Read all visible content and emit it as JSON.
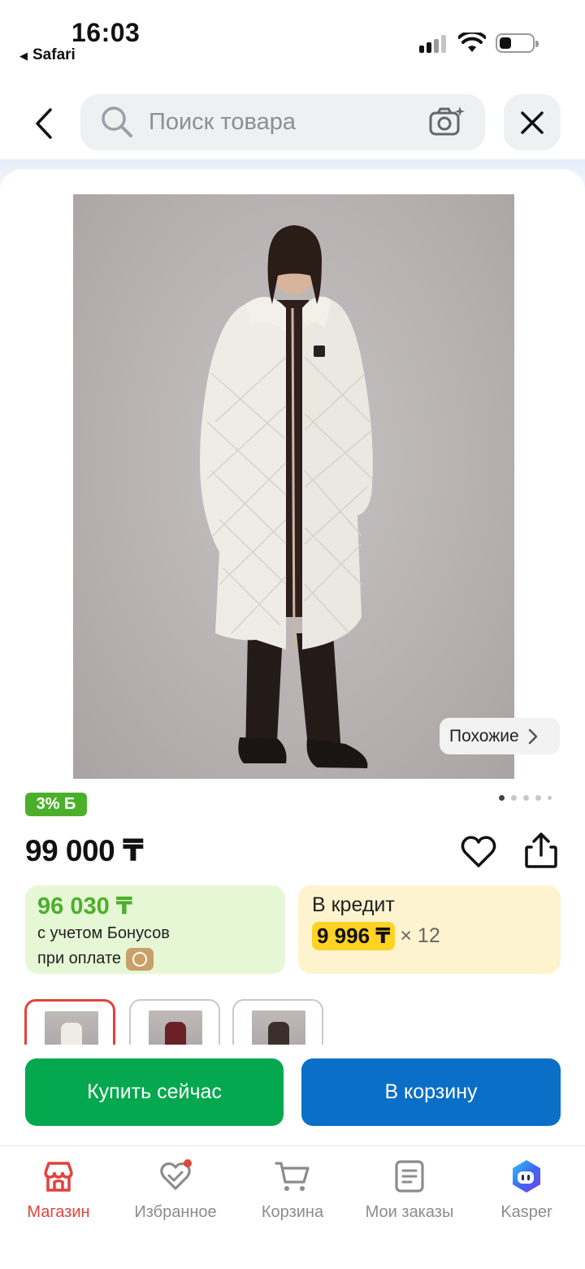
{
  "status_bar": {
    "time": "16:03",
    "back_app": "Safari"
  },
  "search": {
    "placeholder": "Поиск товара"
  },
  "product": {
    "similar_label": "Похожие",
    "bonus_badge": "3% Б",
    "price": "99 000 ₸",
    "gallery": {
      "current": 1,
      "total": 5
    },
    "bonus_price": "96 030 ₸",
    "bonus_line1": "с учетом Бонусов",
    "bonus_line2": "при оплате",
    "credit_title": "В кредит",
    "credit_price": "9 996 ₸",
    "credit_months": "× 12"
  },
  "variants": [
    {
      "color": "#efece6",
      "selected": true
    },
    {
      "color": "#6b1f26",
      "selected": false
    },
    {
      "color": "#3a2f2c",
      "selected": false
    }
  ],
  "actions": {
    "buy_now": "Купить сейчас",
    "add_to_cart": "В корзину"
  },
  "tabbar": {
    "items": [
      {
        "label": "Магазин",
        "icon": "store-icon",
        "active": true
      },
      {
        "label": "Избранное",
        "icon": "heart-icon",
        "active": false
      },
      {
        "label": "Корзина",
        "icon": "cart-icon",
        "active": false
      },
      {
        "label": "Мои заказы",
        "icon": "orders-icon",
        "active": false
      },
      {
        "label": "Kasper",
        "icon": "kasper-icon",
        "active": false
      }
    ]
  },
  "colors": {
    "accent_red": "#e0443c",
    "buy_green": "#05a84f",
    "cart_blue": "#0a6fc7",
    "bonus_green": "#4caf2a",
    "credit_yellow": "#ffd224"
  }
}
